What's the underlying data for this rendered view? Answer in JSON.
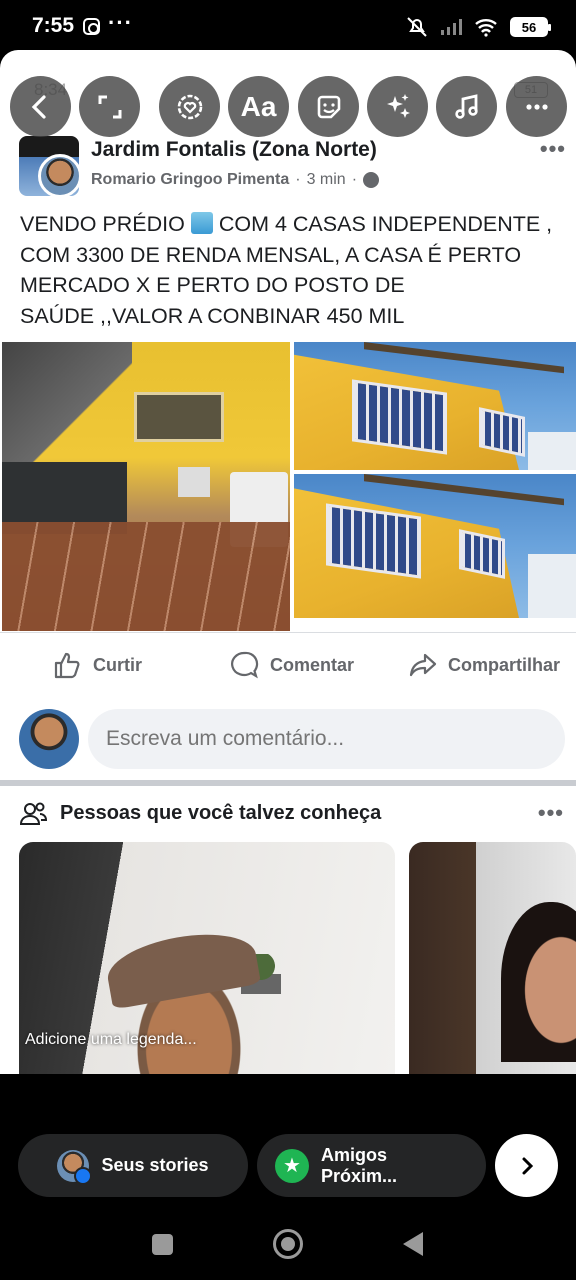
{
  "status_bar": {
    "time": "7:55",
    "battery": "56",
    "overlay_time": "8:34",
    "overlay_battery": "51"
  },
  "editor_tools": [
    {
      "icon": "back-arrow-icon"
    },
    {
      "icon": "resize-icon"
    },
    {
      "icon": "sticker-icon"
    },
    {
      "icon": "text-icon",
      "label": "Aa"
    },
    {
      "icon": "emoji-sticker-icon"
    },
    {
      "icon": "effects-icon"
    },
    {
      "icon": "music-icon"
    },
    {
      "icon": "more-icon"
    }
  ],
  "post": {
    "group_name": "Jardim Fontalis (Zona Norte)",
    "author": "Romario Gringoo Pimenta",
    "time": "3 min",
    "text_line1_a": "VENDO PRÉDIO",
    "text_line1_b": "COM 4 CASAS INDEPENDENTE ,",
    "text_line2": "COM 3300 DE RENDA MENSAL, A CASA É PERTO",
    "text_line3": "MERCADO X  E PERTO DO POSTO DE",
    "text_line4": "SAÚDE ,,VALOR A CONBINAR 450 MIL"
  },
  "actions": {
    "like": "Curtir",
    "comment": "Comentar",
    "share": "Compartilhar"
  },
  "comment_box": {
    "placeholder": "Escreva um comentário..."
  },
  "pymk": {
    "title": "Pessoas que você talvez conheça",
    "card1_caption": "Adicione uma legenda..."
  },
  "bottom": {
    "stories": "Seus stories",
    "close_friends": "Amigos Próxim..."
  },
  "colors": {
    "accent": "#1877f2",
    "green": "#1fb553",
    "secondary_text": "#65676b"
  }
}
